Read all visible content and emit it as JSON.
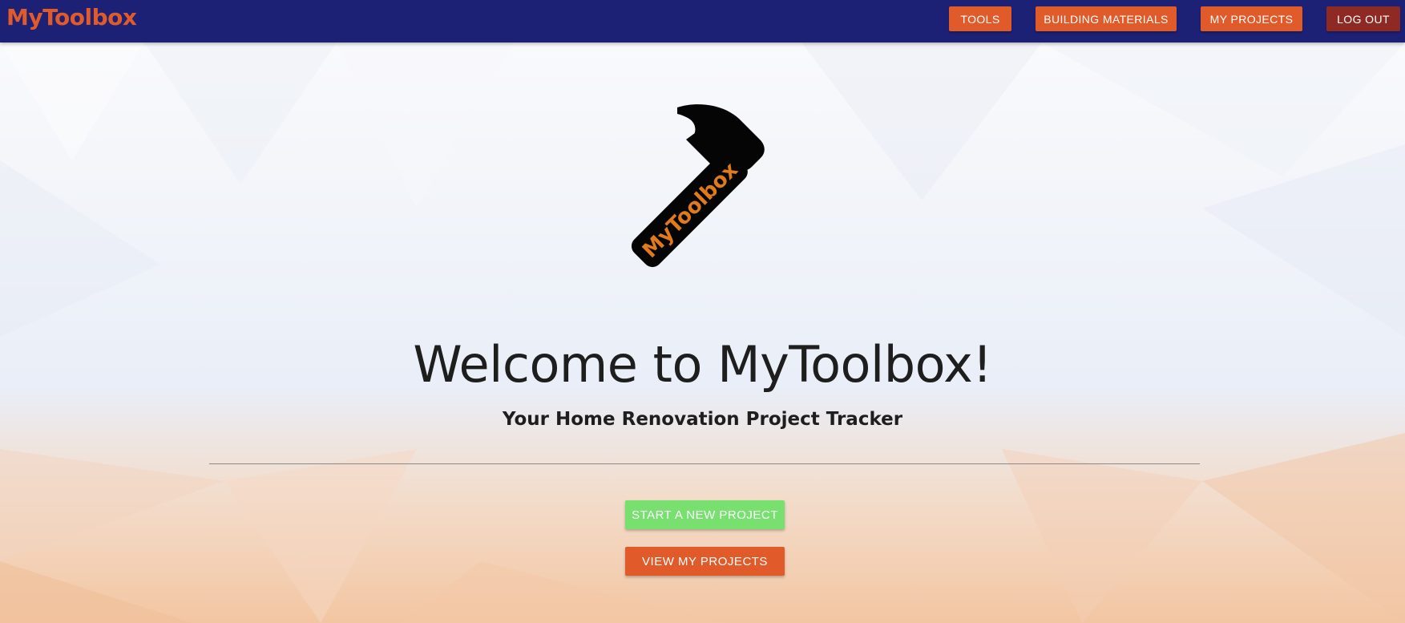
{
  "navbar": {
    "brand": "MyToolbox",
    "links": {
      "tools": "TOOLS",
      "building_materials": "BUILDING MATERIALS",
      "my_projects": "MY PROJECTS",
      "log_out": "LOG OUT"
    }
  },
  "hero": {
    "logo_icon": "hammer-icon",
    "logo_text": "MyToolbox",
    "title": "Welcome to MyToolbox!",
    "subtitle": "Your Home Renovation Project Tracker",
    "buttons": {
      "start_new_project": "START A NEW PROJECT",
      "view_my_projects": "VIEW MY PROJECTS"
    }
  },
  "colors": {
    "navbar": "#1c2176",
    "accent_orange": "#e05a2a",
    "logout_red": "#8e2a23",
    "start_green": "#78e06e"
  }
}
